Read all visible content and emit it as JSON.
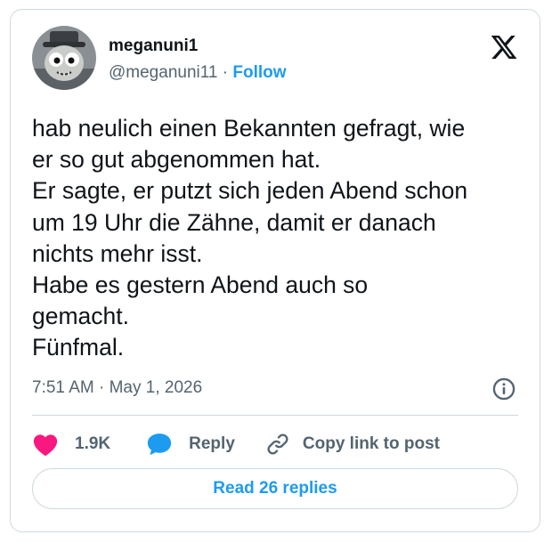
{
  "author": {
    "display_name": "meganuni1",
    "handle": "@meganuni11",
    "separator": " · ",
    "follow_label": "Follow"
  },
  "tweet": {
    "lines": [
      "hab neulich einen Bekannten gefragt, wie",
      "er so gut abgenommen hat.",
      "Er sagte, er putzt sich jeden Abend schon",
      "um 19 Uhr die Zähne, damit er danach",
      "nichts mehr isst.",
      "Habe es gestern Abend auch so",
      "gemacht.",
      "Fünfmal."
    ],
    "timestamp": "7:51 AM · May 1, 2026"
  },
  "actions": {
    "like_count": "1.9K",
    "reply_label": "Reply",
    "copy_link_label": "Copy link to post"
  },
  "footer": {
    "read_replies_label": "Read 26 replies"
  },
  "icons": {
    "logo": "x-logo-icon",
    "info": "info-icon",
    "like": "heart-icon",
    "reply": "speech-bubble-icon",
    "copy": "link-icon"
  },
  "colors": {
    "accent": "#1d9bf0",
    "like": "#f91880",
    "text": "#0f1419",
    "muted": "#536471",
    "border": "#cfd9de"
  }
}
